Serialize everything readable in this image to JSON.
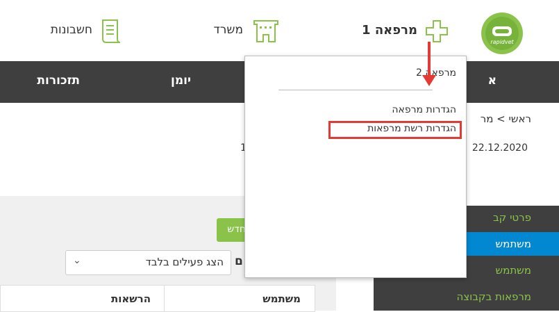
{
  "topbar": {
    "clinic_label": "מרפאה 1",
    "office_label": "משרד",
    "accounts_label": "חשבונות",
    "logo_text": "rapidvet"
  },
  "nav": {
    "reminders": "תזכורות",
    "diary": "יומן",
    "partial_item": "א"
  },
  "breadcrumb": "ראשי > מר",
  "date": "22.12.2020",
  "partial_number": "1",
  "dropdown": {
    "clinic2": "מרפאה 2",
    "clinic_settings": "הגדרות מרפאה",
    "network_settings": "הגדרות רשת מרפאות"
  },
  "sidebar": {
    "items": [
      {
        "label": "פרטי קב"
      },
      {
        "label": "משתמש"
      },
      {
        "label": "משתמש"
      },
      {
        "label": "מרפאות בקבוצה"
      }
    ]
  },
  "left": {
    "new_button": "חדש",
    "partial_letter": "ם",
    "filter_value": "הצג פעילים בלבד",
    "col_user": "משתמש",
    "col_permissions": "הרשאות"
  },
  "colors": {
    "accent": "#8bc34a",
    "nav_bg": "#3f3f3f",
    "active_blue": "#0288d1",
    "highlight_red": "#e53935"
  }
}
